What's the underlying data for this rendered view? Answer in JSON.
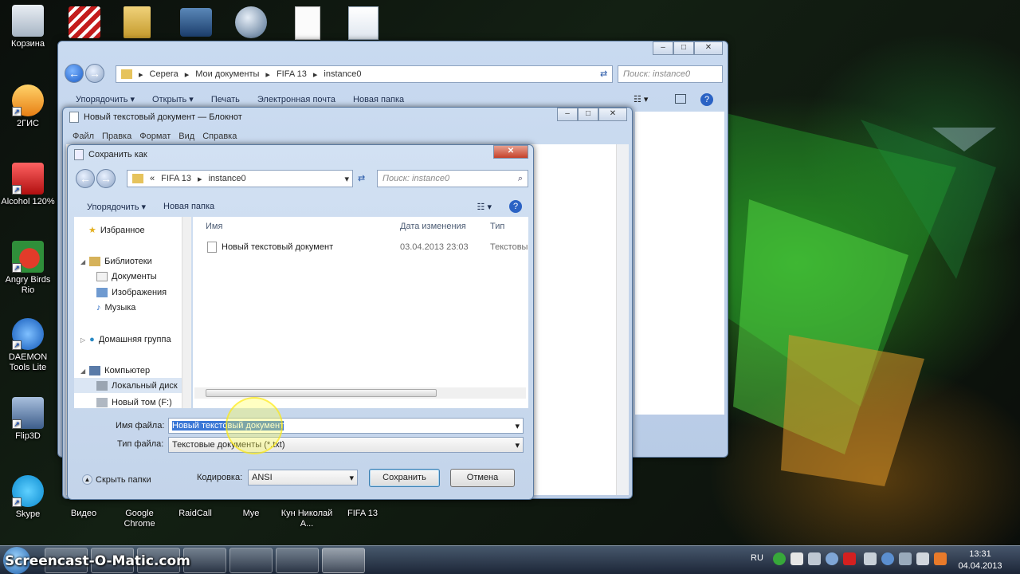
{
  "desktop": {
    "left_icons": [
      {
        "label": "Корзина",
        "icon": "recycle-bin-icon",
        "color": "#cfd8e2"
      },
      {
        "label": "2ГИС",
        "icon": "2gis-icon",
        "color": "#f5a623"
      },
      {
        "label": "Alcohol 120%",
        "icon": "alcohol-icon",
        "color": "#d62020"
      },
      {
        "label": "Angry Birds Rio",
        "icon": "angry-birds-icon",
        "color": "#2f8f3a"
      },
      {
        "label": "DAEMON Tools Lite",
        "icon": "daemon-tools-icon",
        "color": "#1f6fd6"
      },
      {
        "label": "Flip3D",
        "icon": "flip3d-icon",
        "color": "#4a6a96"
      },
      {
        "label": "Skype",
        "icon": "skype-icon",
        "color": "#1aa3e8"
      }
    ],
    "bottom_icons": [
      {
        "label": "Видео"
      },
      {
        "label": "Google Chrome"
      },
      {
        "label": "RaidCall"
      },
      {
        "label": "Mуe"
      },
      {
        "label": "Кун Николай А..."
      },
      {
        "label": "FIFA 13"
      }
    ]
  },
  "explorer": {
    "path": [
      "Серега",
      "Мои документы",
      "FIFA 13",
      "instance0"
    ],
    "search_placeholder": "Поиск: instance0",
    "toolbar": [
      "Упорядочить",
      "Открыть",
      "Печать",
      "Электронная почта",
      "Новая папка"
    ]
  },
  "notepad": {
    "title": "Новый текстовый документ — Блокнот",
    "menu": [
      "Файл",
      "Правка",
      "Формат",
      "Вид",
      "Справка"
    ]
  },
  "save_dialog": {
    "title": "Сохранить как",
    "path": [
      "FIFA 13",
      "instance0"
    ],
    "path_prefix": "«",
    "search_placeholder": "Поиск: instance0",
    "toolbar": {
      "organize": "Упорядочить",
      "new_folder": "Новая папка"
    },
    "nav": {
      "favorites": "Избранное",
      "libraries": "Библиотеки",
      "documents": "Документы",
      "images": "Изображения",
      "music": "Музыка",
      "homegroup": "Домашняя группа",
      "computer": "Компьютер",
      "local_disk": "Локальный диск",
      "new_volume": "Новый том (F:)"
    },
    "columns": {
      "name": "Имя",
      "date": "Дата изменения",
      "type": "Тип"
    },
    "files": [
      {
        "name": "Новый текстовый документ",
        "date": "03.04.2013 23:03",
        "type": "Текстовы"
      }
    ],
    "filename_label": "Имя файла:",
    "filename_value": "Новый текстовый документ",
    "filetype_label": "Тип файла:",
    "filetype_value": "Текстовые документы (*.txt)",
    "encoding_label": "Кодировка:",
    "encoding_value": "ANSI",
    "hide_folders": "Скрыть папки",
    "save": "Сохранить",
    "cancel": "Отмена"
  },
  "taskbar": {
    "language": "RU",
    "time": "13:31",
    "date": "04.04.2013",
    "watermark": "Screencast-O-Matic.com"
  }
}
